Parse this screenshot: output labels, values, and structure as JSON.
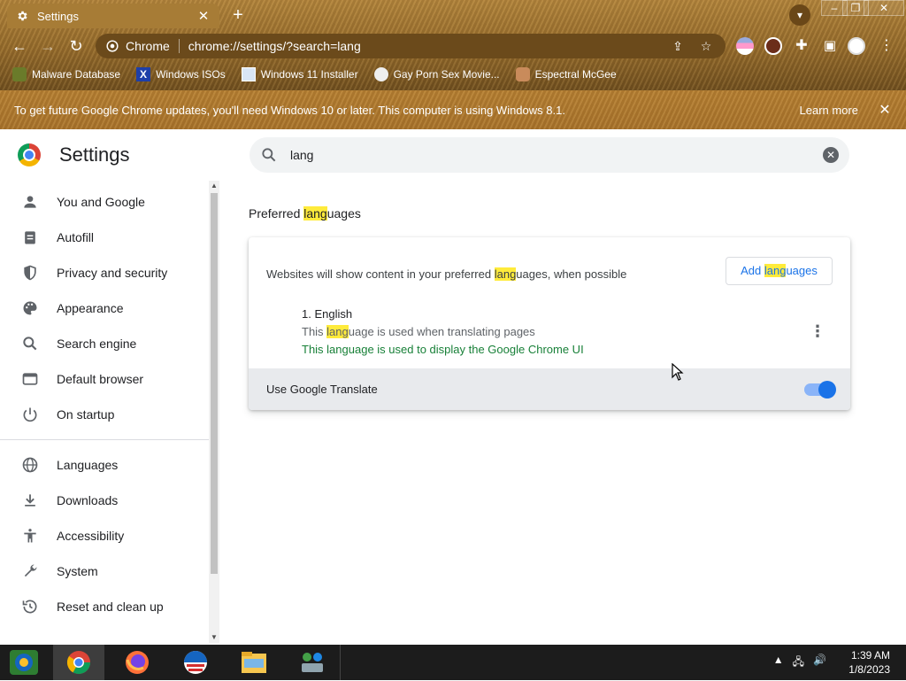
{
  "browser": {
    "tab_title": "Settings",
    "new_tab": "+",
    "omnibox_site": "Chrome",
    "omnibox_url": "chrome://settings/?search=lang",
    "bookmarks": [
      {
        "label": "Malware Database"
      },
      {
        "label": "Windows ISOs"
      },
      {
        "label": "Windows 11 Installer"
      },
      {
        "label": "Gay Porn Sex Movie..."
      },
      {
        "label": "Espectral McGee"
      }
    ],
    "infobar": {
      "message": "To get future Google Chrome updates, you'll need Windows 10 or later. This computer is using Windows 8.1.",
      "learn_more": "Learn more"
    }
  },
  "settings": {
    "title": "Settings",
    "search_value": "lang",
    "sidebar": [
      {
        "label": "You and Google",
        "icon": "person-icon"
      },
      {
        "label": "Autofill",
        "icon": "clipboard-icon"
      },
      {
        "label": "Privacy and security",
        "icon": "shield-icon"
      },
      {
        "label": "Appearance",
        "icon": "palette-icon"
      },
      {
        "label": "Search engine",
        "icon": "search-icon"
      },
      {
        "label": "Default browser",
        "icon": "browser-icon"
      },
      {
        "label": "On startup",
        "icon": "power-icon"
      },
      {
        "label": "Languages",
        "icon": "globe-icon"
      },
      {
        "label": "Downloads",
        "icon": "download-icon"
      },
      {
        "label": "Accessibility",
        "icon": "accessibility-icon"
      },
      {
        "label": "System",
        "icon": "wrench-icon"
      },
      {
        "label": "Reset and clean up",
        "icon": "history-icon"
      }
    ],
    "section": {
      "title_pre": "Preferred ",
      "title_hl": "lang",
      "title_post": "uages",
      "desc_pre": "Websites will show content in your preferred ",
      "desc_hl": "lang",
      "desc_post": "uages, when possible",
      "add_pre": "Add ",
      "add_hl": "lang",
      "add_post": "uages",
      "language_name": "1. English",
      "lang_sub1_pre": "This ",
      "lang_sub1_hl": "lang",
      "lang_sub1_post": "uage is used when translating pages",
      "lang_sub2": "This language is used to display the Google Chrome UI",
      "translate_label": "Use Google Translate",
      "translate_enabled": true
    }
  },
  "taskbar": {
    "time": "1:39 AM",
    "date": "1/8/2023"
  },
  "colors": {
    "accent": "#1a73e8",
    "highlight": "#ffeb3b",
    "ui_language_green": "#188038"
  }
}
